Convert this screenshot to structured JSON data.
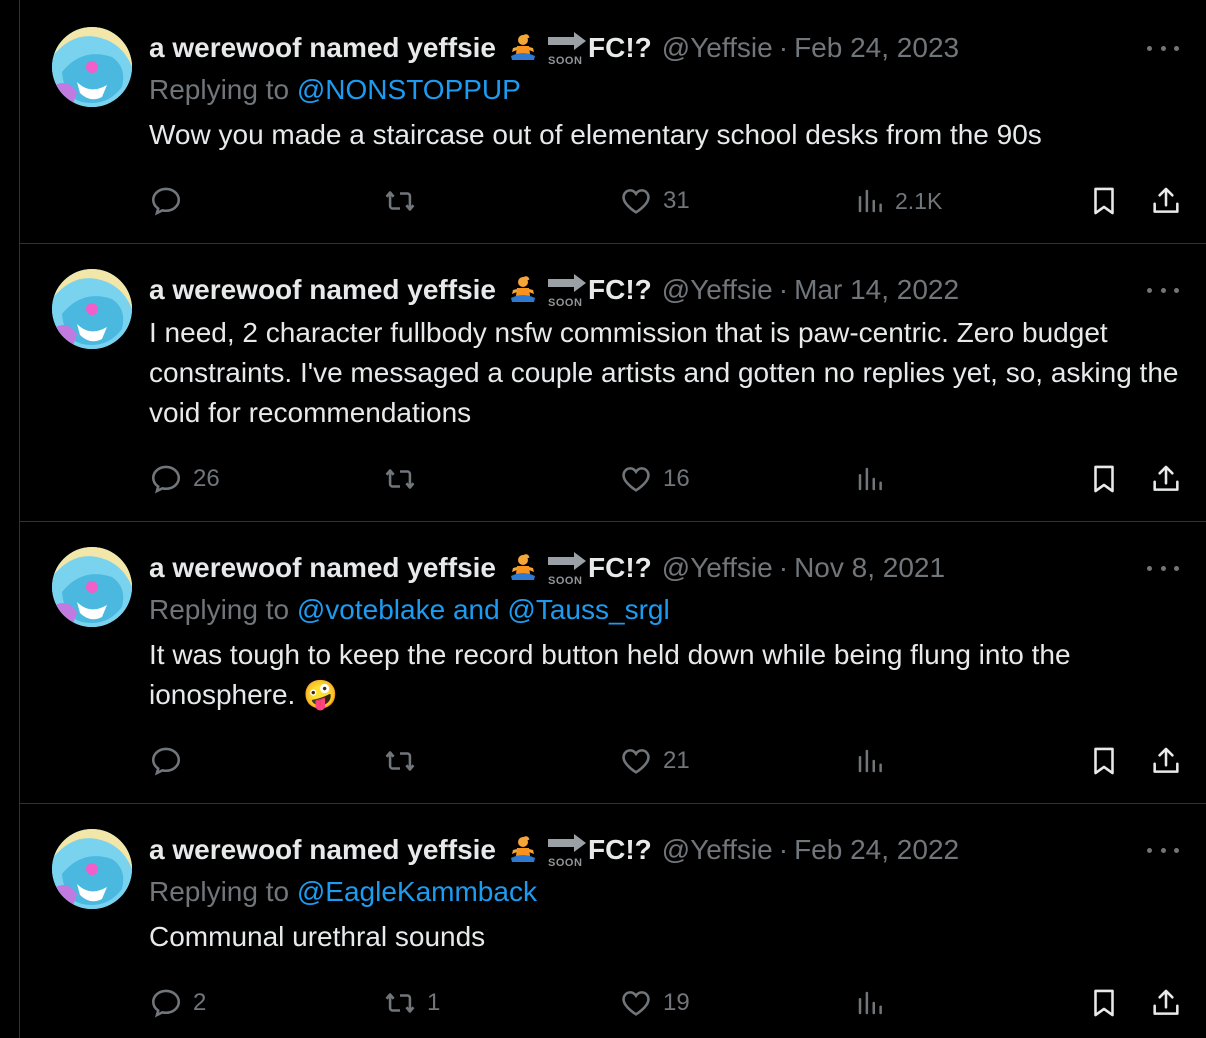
{
  "author": {
    "display_name": "a werewoof named yeffsie",
    "emoji_icon": "person-in-lotus-position-icon",
    "soon_label": "SOON",
    "fc_label": "FC!?",
    "handle": "@Yeffsie",
    "separator": "·"
  },
  "replying_prefix": "Replying to",
  "colors": {
    "background": "#000000",
    "text": "#e7e9ea",
    "muted": "#71767b",
    "link": "#1d9bf0",
    "border": "#2f3336"
  },
  "tweets": [
    {
      "date": "Feb 24, 2023",
      "replying_to": "@NONSTOPPUP",
      "text": "Wow you made a staircase out of elementary school desks from the 90s",
      "reply_count": "",
      "retweet_count": "",
      "like_count": "31",
      "view_count": "2.1K"
    },
    {
      "date": "Mar 14, 2022",
      "replying_to": "",
      "text": "I need, 2 character fullbody nsfw commission that is paw-centric. Zero budget constraints. I've messaged a couple artists and gotten no replies yet, so, asking the void for recommendations",
      "reply_count": "26",
      "retweet_count": "",
      "like_count": "16",
      "view_count": ""
    },
    {
      "date": "Nov 8, 2021",
      "replying_to": "@voteblake and @Tauss_srgl",
      "text": "It was tough to keep the record button held down while being flung into the ionosphere. 🤪",
      "reply_count": "",
      "retweet_count": "",
      "like_count": "21",
      "view_count": ""
    },
    {
      "date": "Feb 24, 2022",
      "replying_to": "@EagleKammback",
      "text": "Communal urethral sounds",
      "reply_count": "2",
      "retweet_count": "1",
      "like_count": "19",
      "view_count": ""
    }
  ]
}
